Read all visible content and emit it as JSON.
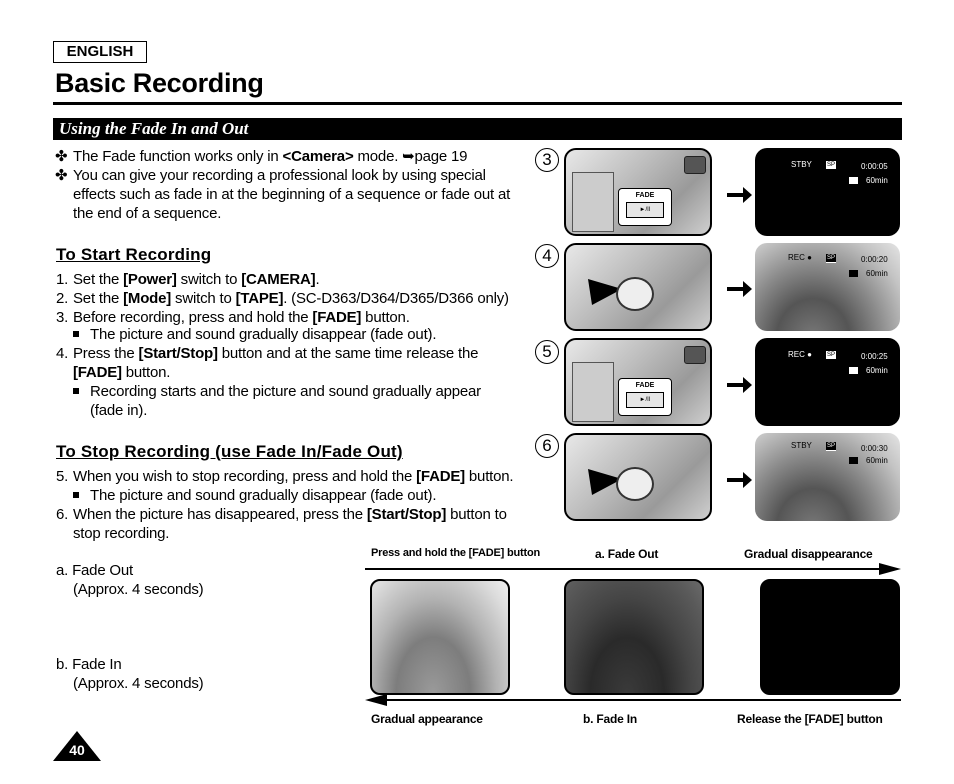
{
  "header": {
    "language_label": "ENGLISH",
    "page_title": "Basic Recording",
    "section_title": "Using the Fade In and Out"
  },
  "intro": {
    "bullets": [
      {
        "mark": "✤",
        "pre": "The Fade function works only in ",
        "bold": "<Camera>",
        "post": " mode. ➥page 19"
      },
      {
        "mark": "✤",
        "lines": [
          "You can give your recording a professional look by using special",
          "effects such as fade in at the beginning of a sequence or fade out at",
          "the end of a sequence."
        ]
      }
    ]
  },
  "start_section": {
    "heading": "To Start Recording",
    "steps": [
      {
        "num": "1.",
        "t1": "Set the ",
        "b1": "[Power]",
        "t2": " switch to ",
        "b2": "[CAMERA]",
        "t3": "."
      },
      {
        "num": "2.",
        "t1": "Set the ",
        "b1": "[Mode]",
        "t2": " switch to ",
        "b2": "[TAPE]",
        "t3": ". (SC-D363/D364/D365/D366 only)"
      },
      {
        "num": "3.",
        "t1": "Before recording, press and hold the ",
        "b1": "[FADE]",
        "t2": " button."
      },
      {
        "num": "4.",
        "t1": "Press the ",
        "b1": "[Start/Stop]",
        "t2": " button and at the same time release the",
        "b2": "[FADE]",
        "t3": " button."
      }
    ],
    "notes": [
      "The picture and sound gradually disappear (fade out).",
      "Recording starts and the picture and sound gradually appear",
      "(fade in)."
    ]
  },
  "stop_section": {
    "heading": "To Stop Recording (use Fade In/Fade Out)",
    "steps": [
      {
        "num": "5.",
        "t1": "When you wish to stop recording, press and hold the ",
        "b1": "[FADE]",
        "t2": " button."
      },
      {
        "num": "6.",
        "t1": "When the picture has disappeared, press the ",
        "b1": "[Start/Stop]",
        "t2": " button to",
        "line2": "stop recording."
      }
    ],
    "notes": [
      "The picture and sound gradually disappear (fade out)."
    ]
  },
  "fade_notes": {
    "a_label": "a. Fade Out",
    "a_duration": "(Approx. 4 seconds)",
    "b_label": "b. Fade In",
    "b_duration": "(Approx. 4 seconds)"
  },
  "figures": [
    {
      "step": "3",
      "camera_label": "FADE",
      "button_glyph": "►/II",
      "status": "STBY",
      "tape_speed": "SP",
      "timecode": "0:00:05",
      "remaining": "60min",
      "screen": "black"
    },
    {
      "step": "4",
      "status": "REC ●",
      "tape_speed": "SP",
      "timecode": "0:00:20",
      "remaining": "60min",
      "screen": "dolphin"
    },
    {
      "step": "5",
      "camera_label": "FADE",
      "button_glyph": "►/II",
      "status": "REC ●",
      "tape_speed": "SP",
      "timecode": "0:00:25",
      "remaining": "60min",
      "screen": "black"
    },
    {
      "step": "6",
      "status": "STBY",
      "tape_speed": "SP",
      "timecode": "0:00:30",
      "remaining": "60min",
      "screen": "dolphin"
    }
  ],
  "timeline": {
    "top_labels": [
      "Press and hold the [FADE] button",
      "a. Fade Out",
      "Gradual disappearance"
    ],
    "bottom_labels": [
      "Gradual appearance",
      "b. Fade In",
      "Release the [FADE] button"
    ]
  },
  "footer": {
    "page_number": "40"
  }
}
